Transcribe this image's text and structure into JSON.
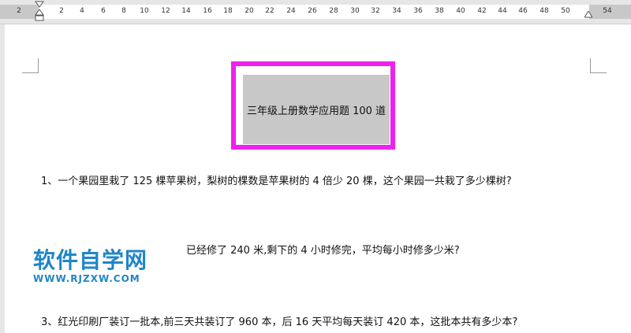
{
  "ruler": {
    "labels": [
      "2",
      "2",
      "4",
      "6",
      "8",
      "10",
      "12",
      "14",
      "16",
      "18",
      "20",
      "22",
      "24",
      "26",
      "28",
      "30",
      "32",
      "34",
      "36",
      "38",
      "40",
      "42",
      "44",
      "46",
      "48",
      "50",
      "54"
    ]
  },
  "document": {
    "title": "三年级上册数学应用题 100 道",
    "questions": [
      "1、一个果园里栽了 125 棵苹果树，梨树的棵数是苹果树的 4 倍少 20 棵，这个果园一共栽了多少棵树?",
      "已经修了 240 米,剩下的 4 小时修完，平均每小时修多少米?",
      "3、红光印刷厂装订一批本,前三天共装订了 960 本，后 16 天平均每天装订 420 本，这批本共有多少本?"
    ]
  },
  "watermark": {
    "title": "软件自学网",
    "url": "WWW.RJZXW.COM"
  },
  "colors": {
    "frame": "#ee22ee",
    "title_box": "#c8c8c8",
    "watermark": "#1f86c8"
  }
}
